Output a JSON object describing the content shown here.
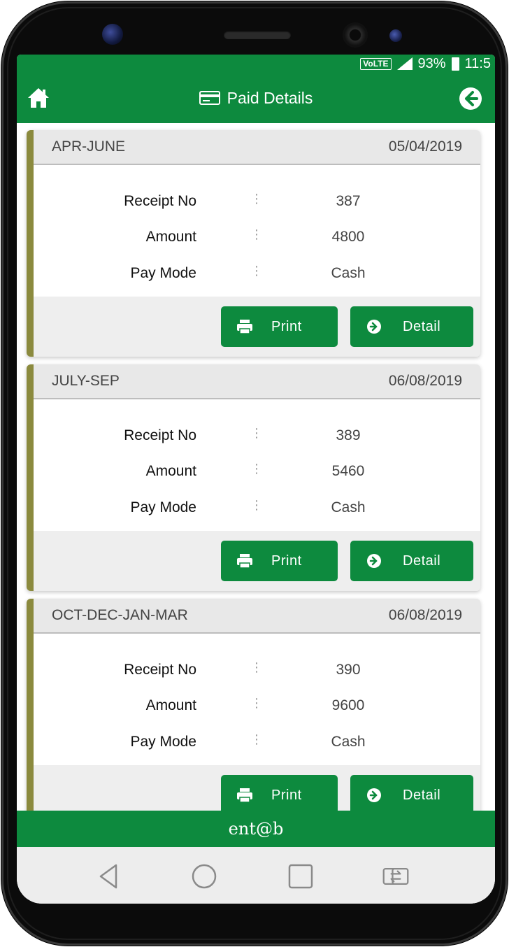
{
  "status_bar": {
    "volte": "VoLTE",
    "battery": "93%",
    "time": "11:5"
  },
  "header": {
    "title": "Paid Details",
    "home_icon": "home-icon",
    "back_icon": "arrow-left-circle-icon",
    "card_icon": "credit-card-icon"
  },
  "receipts": [
    {
      "period": "APR-JUNE",
      "date": "05/04/2019",
      "receipt_no": "387",
      "amount": "4800",
      "pay_mode": "Cash"
    },
    {
      "period": "JULY-SEP",
      "date": "06/08/2019",
      "receipt_no": "389",
      "amount": "5460",
      "pay_mode": "Cash"
    },
    {
      "period": "OCT-DEC-JAN-MAR",
      "date": "06/08/2019",
      "receipt_no": "390",
      "amount": "9600",
      "pay_mode": "Cash"
    }
  ],
  "labels": {
    "receipt_no": "Receipt No",
    "amount": "Amount",
    "pay_mode": "Pay Mode",
    "separator": "⋮"
  },
  "buttons": {
    "print": "Print",
    "detail": "Detail"
  },
  "footer": {
    "brand": "ent@b"
  },
  "colors": {
    "primary": "#0d8a3e",
    "card_accent": "#8b8a3e",
    "header_gray": "#e8e8e8"
  }
}
